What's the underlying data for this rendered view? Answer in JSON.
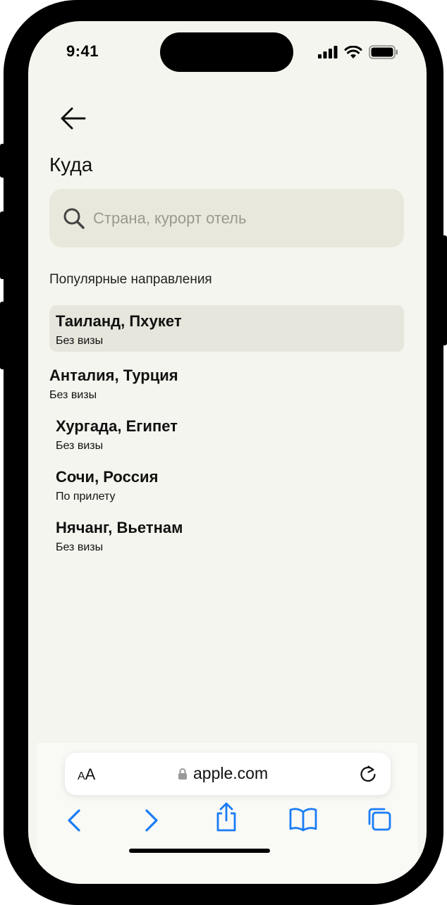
{
  "status_bar": {
    "time": "9:41"
  },
  "page": {
    "title": "Куда",
    "search_placeholder": "Страна, курорт отель",
    "section_title": "Популярные направления"
  },
  "destinations": [
    {
      "name": "Таиланд, Пхукет",
      "note": "Без визы",
      "highlighted": true
    },
    {
      "name": "Анталия, Турция",
      "note": "Без визы"
    },
    {
      "name": "Хургада, Египет",
      "note": "Без визы"
    },
    {
      "name": "Сочи, Россия",
      "note": "По прилету"
    },
    {
      "name": "Нячанг, Вьетнам",
      "note": "Без визы"
    }
  ],
  "browser": {
    "aa_big": "A",
    "aa_small": "A",
    "url": "apple.com",
    "accent_color": "#1a7cf5"
  },
  "icons": {
    "back": "arrow-left-icon",
    "search": "magnifier-icon",
    "lock": "lock-icon",
    "reload": "reload-icon",
    "nav_back": "chevron-left-icon",
    "nav_forward": "chevron-right-icon",
    "share": "share-icon",
    "bookmarks": "book-icon",
    "tabs": "tabs-icon"
  }
}
